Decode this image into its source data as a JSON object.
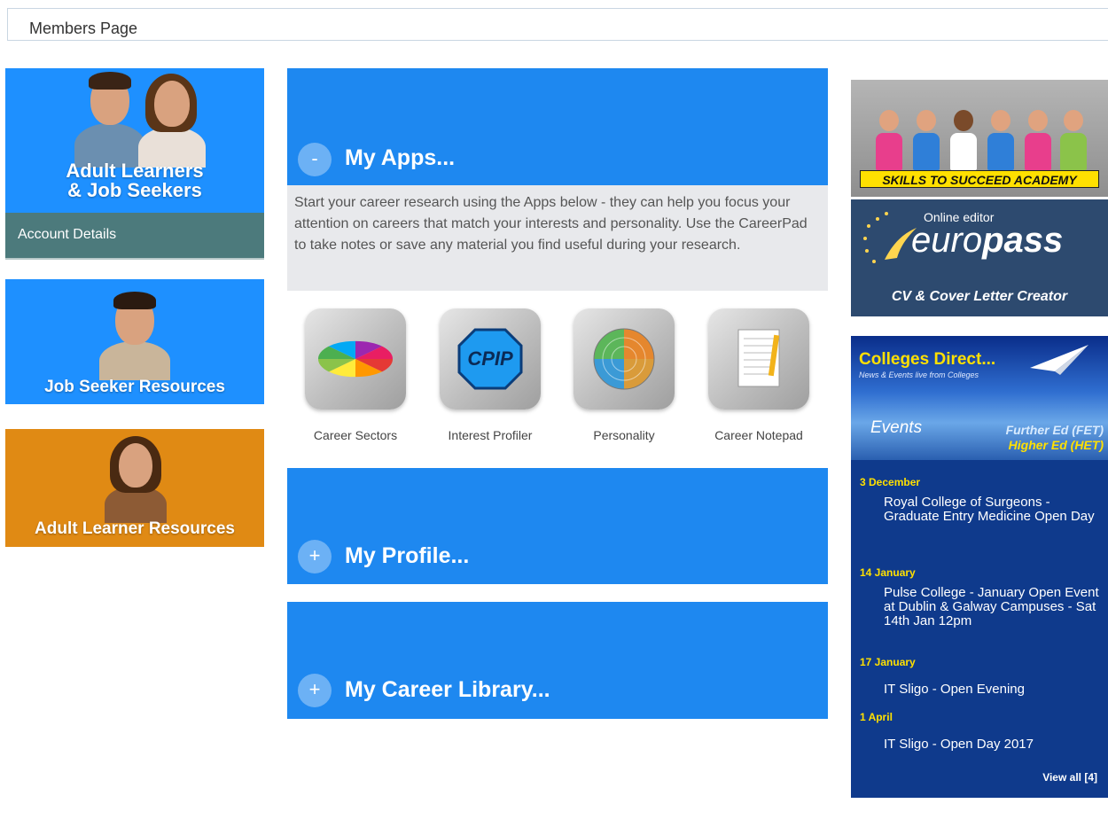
{
  "header": {
    "title": "Members Page"
  },
  "left": {
    "adult_job_caption_line1": "Adult Learners",
    "adult_job_caption_line2": "& Job Seekers",
    "account_details": "Account Details",
    "job_seeker_caption": "Job Seeker Resources",
    "adult_learner_caption": "Adult Learner Resources"
  },
  "apps": {
    "toggle": "-",
    "title": "My Apps...",
    "description": "Start your career research using the Apps below - they can help you focus your attention on careers that match your interests and personality. Use the CareerPad to take notes or save any material you find useful during your research.",
    "items": [
      {
        "label": "Career Sectors",
        "icon": "pie-chart-icon"
      },
      {
        "label": "Interest Profiler",
        "icon": "cpip-icon",
        "icon_text": "CPIP"
      },
      {
        "label": "Personality",
        "icon": "radar-wheel-icon"
      },
      {
        "label": "Career Notepad",
        "icon": "notepad-icon"
      }
    ]
  },
  "profile": {
    "toggle": "+",
    "title": "My Profile..."
  },
  "library": {
    "toggle": "+",
    "title": "My Career Library..."
  },
  "right": {
    "skills_banner": "SKILLS TO SUCCEED ACADEMY",
    "europass_online": "Online editor",
    "europass_logo_a": "euro",
    "europass_logo_b": "pass",
    "europass_sub": "CV & Cover Letter Creator",
    "colleges": {
      "title": "Colleges Direct...",
      "subtitle": "News & Events live from Colleges",
      "events_label": "Events",
      "fet": "Further Ed (FET)",
      "het": "Higher Ed (HET)",
      "events": [
        {
          "date": "3 December",
          "title": "Royal College of Surgeons - Graduate Entry Medicine Open Day"
        },
        {
          "date": "14 January",
          "title": "Pulse College - January Open Event at Dublin & Galway Campuses - Sat 14th Jan 12pm"
        },
        {
          "date": "17 January",
          "title": "IT Sligo - Open Evening"
        },
        {
          "date": "1 April",
          "title": "IT Sligo - Open Day 2017"
        }
      ],
      "view_all": "View all [4]"
    }
  },
  "colors": {
    "blue": "#1e88f0",
    "orange": "#e08a14",
    "teal": "#4c7a7c",
    "navy": "#0f3a8c",
    "yellow": "#ffe000"
  }
}
